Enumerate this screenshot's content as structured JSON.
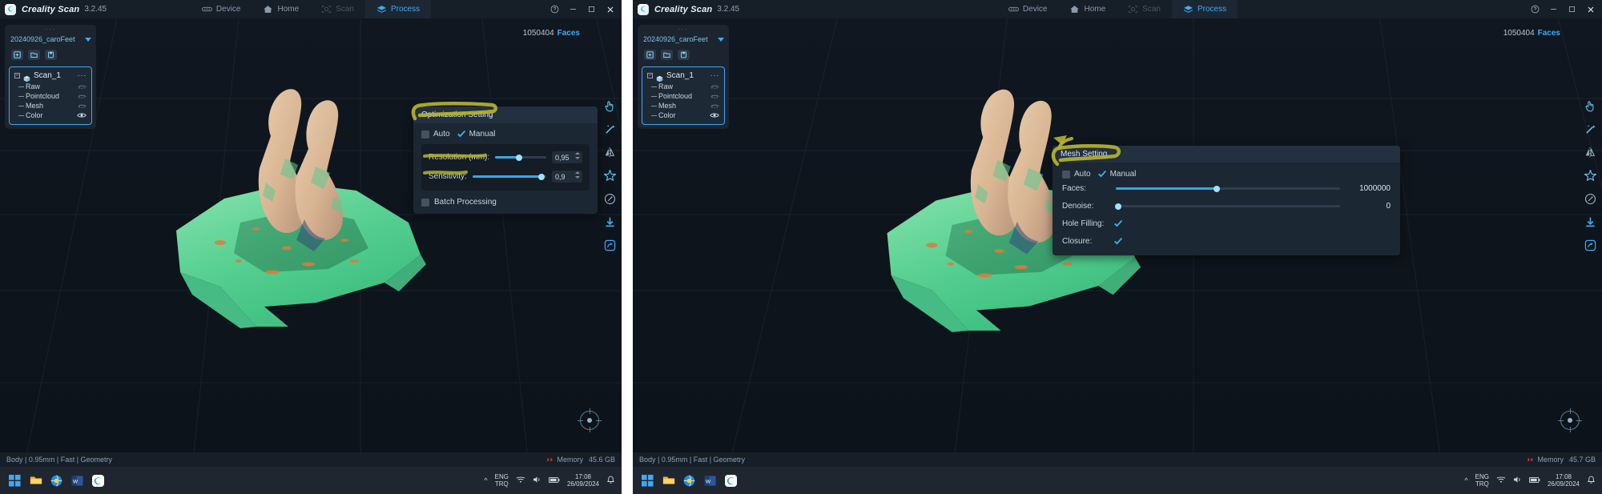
{
  "app": {
    "name": "Creality Scan",
    "version": "3.2.45",
    "logo_icon": "creality-logo-icon"
  },
  "nav": {
    "tabs": [
      {
        "label": "Device",
        "icon": "device-icon",
        "state": "normal"
      },
      {
        "label": "Home",
        "icon": "home-icon",
        "state": "normal"
      },
      {
        "label": "Scan",
        "icon": "scan-icon",
        "state": "disabled"
      },
      {
        "label": "Process",
        "icon": "process-icon",
        "state": "active"
      }
    ],
    "active_tab": "Process"
  },
  "window_controls": {
    "help": "help-icon",
    "minimize": "minimize-icon",
    "maximize": "maximize-icon",
    "close": "close-icon"
  },
  "viewport": {
    "faces_count": "1050404",
    "faces_label": "Faces",
    "gizmo": "view-gizmo-icon"
  },
  "tree_panel": {
    "grip": "···",
    "project_name": "20240926_caroFeet",
    "dropdown_icon": "chevron-down-icon",
    "tools": [
      {
        "icon": "add-scan-icon"
      },
      {
        "icon": "import-folder-icon"
      },
      {
        "icon": "save-project-icon"
      }
    ],
    "root": {
      "expander": "−",
      "icon": "mesh-cube-icon",
      "label": "Scan_1",
      "menu": "···"
    },
    "children": [
      {
        "label": "Raw",
        "right_icon": "eye-hidden-icon"
      },
      {
        "label": "Pointcloud",
        "right_icon": "eye-hidden-icon"
      },
      {
        "label": "Mesh",
        "right_icon": "eye-hidden-icon"
      },
      {
        "label": "Color",
        "right_icon": "eye-visible-icon"
      }
    ]
  },
  "vertical_toolbar": {
    "items": [
      {
        "icon": "hand-select-icon"
      },
      {
        "icon": "magic-wand-icon"
      },
      {
        "icon": "mirror-icon"
      },
      {
        "icon": "simplify-star-icon"
      },
      {
        "icon": "texture-paint-icon"
      },
      {
        "icon": "download-icon"
      },
      {
        "icon": "share-export-icon"
      }
    ]
  },
  "optimization_dialog": {
    "title": "Optimization Setting",
    "mode": {
      "auto": {
        "label": "Auto",
        "checked": false
      },
      "manual": {
        "label": "Manual",
        "checked": true
      }
    },
    "resolution": {
      "label": "Resolution (mm):",
      "value": "0,95",
      "slider_percent": 46
    },
    "sensitivity": {
      "label": "Sensitivity:",
      "value": "0,9",
      "slider_percent": 93
    },
    "batch": {
      "label": "Batch Processing",
      "checked": false
    },
    "highlight_color": "#b5b32e"
  },
  "mesh_dialog": {
    "title": "Mesh Setting",
    "mode": {
      "auto": {
        "label": "Auto",
        "checked": false
      },
      "manual": {
        "label": "Manual",
        "checked": true
      }
    },
    "faces": {
      "label": "Faces:",
      "value": "1000000",
      "slider_percent": 45
    },
    "denoise": {
      "label": "Denoise:",
      "value": "0",
      "slider_percent": 0
    },
    "hole_filling": {
      "label": "Hole Filling:",
      "checked": true
    },
    "closure": {
      "label": "Closure:",
      "checked": true
    },
    "highlight_color": "#b5b32e"
  },
  "status_bar": {
    "left_text": "Body | 0.95mm | Fast | Geometry",
    "memory_label": "Memory",
    "memory_value_left": "45.6 GB",
    "memory_value_right": "45.7 GB",
    "glasses_icon": "3d-glasses-icon"
  },
  "taskbar": {
    "icons": [
      {
        "icon": "windows-start-icon"
      },
      {
        "icon": "file-explorer-icon"
      },
      {
        "icon": "browser-icon"
      },
      {
        "icon": "office-app-icon"
      },
      {
        "icon": "creality-scan-icon"
      }
    ],
    "overflow_icon": "caret-up-icon",
    "language_line1": "ENG",
    "language_line2": "TRQ",
    "tray_icons": [
      "wifi-icon",
      "volume-icon",
      "battery-icon"
    ],
    "time": "17:08",
    "date": "26/09/2024",
    "notification_icon": "bell-icon"
  }
}
